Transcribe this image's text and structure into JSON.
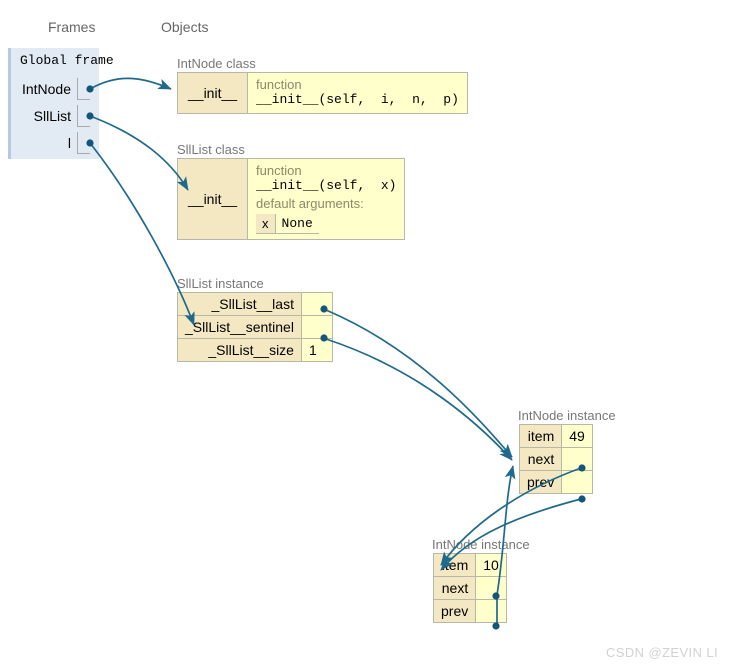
{
  "headers": {
    "frames": "Frames",
    "objects": "Objects"
  },
  "global_frame": {
    "title": "Global frame",
    "variables": [
      {
        "name": "IntNode",
        "points_to": "IntNode class"
      },
      {
        "name": "SllList",
        "points_to": "SllList class"
      },
      {
        "name": "l",
        "points_to": "SllList instance"
      }
    ]
  },
  "objects": {
    "intnode_class": {
      "label": "IntNode class",
      "member_name": "__init__",
      "kind": "function",
      "signature": "__init__(self,  i,  n,  p)"
    },
    "slllist_class": {
      "label": "SllList class",
      "member_name": "__init__",
      "kind": "function",
      "signature": "__init__(self,  x)",
      "default_arguments_label": "default arguments:",
      "default_arguments": [
        {
          "key": "x",
          "value": "None"
        }
      ]
    },
    "slllist_instance": {
      "label": "SllList instance",
      "fields": [
        {
          "key": "_SllList__last",
          "value": "",
          "is_pointer": true
        },
        {
          "key": "_SllList__sentinel",
          "value": "",
          "is_pointer": true
        },
        {
          "key": "_SllList__size",
          "value": "1",
          "is_pointer": false
        }
      ]
    },
    "intnode_instance_1": {
      "label": "IntNode instance",
      "fields": [
        {
          "key": "item",
          "value": "49",
          "is_pointer": false
        },
        {
          "key": "next",
          "value": "",
          "is_pointer": true
        },
        {
          "key": "prev",
          "value": "",
          "is_pointer": true
        }
      ]
    },
    "intnode_instance_2": {
      "label": "IntNode instance",
      "fields": [
        {
          "key": "item",
          "value": "10",
          "is_pointer": false
        },
        {
          "key": "next",
          "value": "",
          "is_pointer": true
        },
        {
          "key": "prev",
          "value": "",
          "is_pointer": true
        }
      ]
    }
  },
  "colors": {
    "frame_bg": "#e2eaf4",
    "frame_edge": "#b6c9e0",
    "key_cell_bg": "#f4e8c2",
    "value_cell_bg": "#ffffcc",
    "box_border": "#999999",
    "arrow": "#1f6a8c",
    "pointer_dot": "#14557a",
    "label_text": "#777777",
    "watermark": "#d2d2d2"
  },
  "watermark": "CSDN @ZEVIN LI"
}
